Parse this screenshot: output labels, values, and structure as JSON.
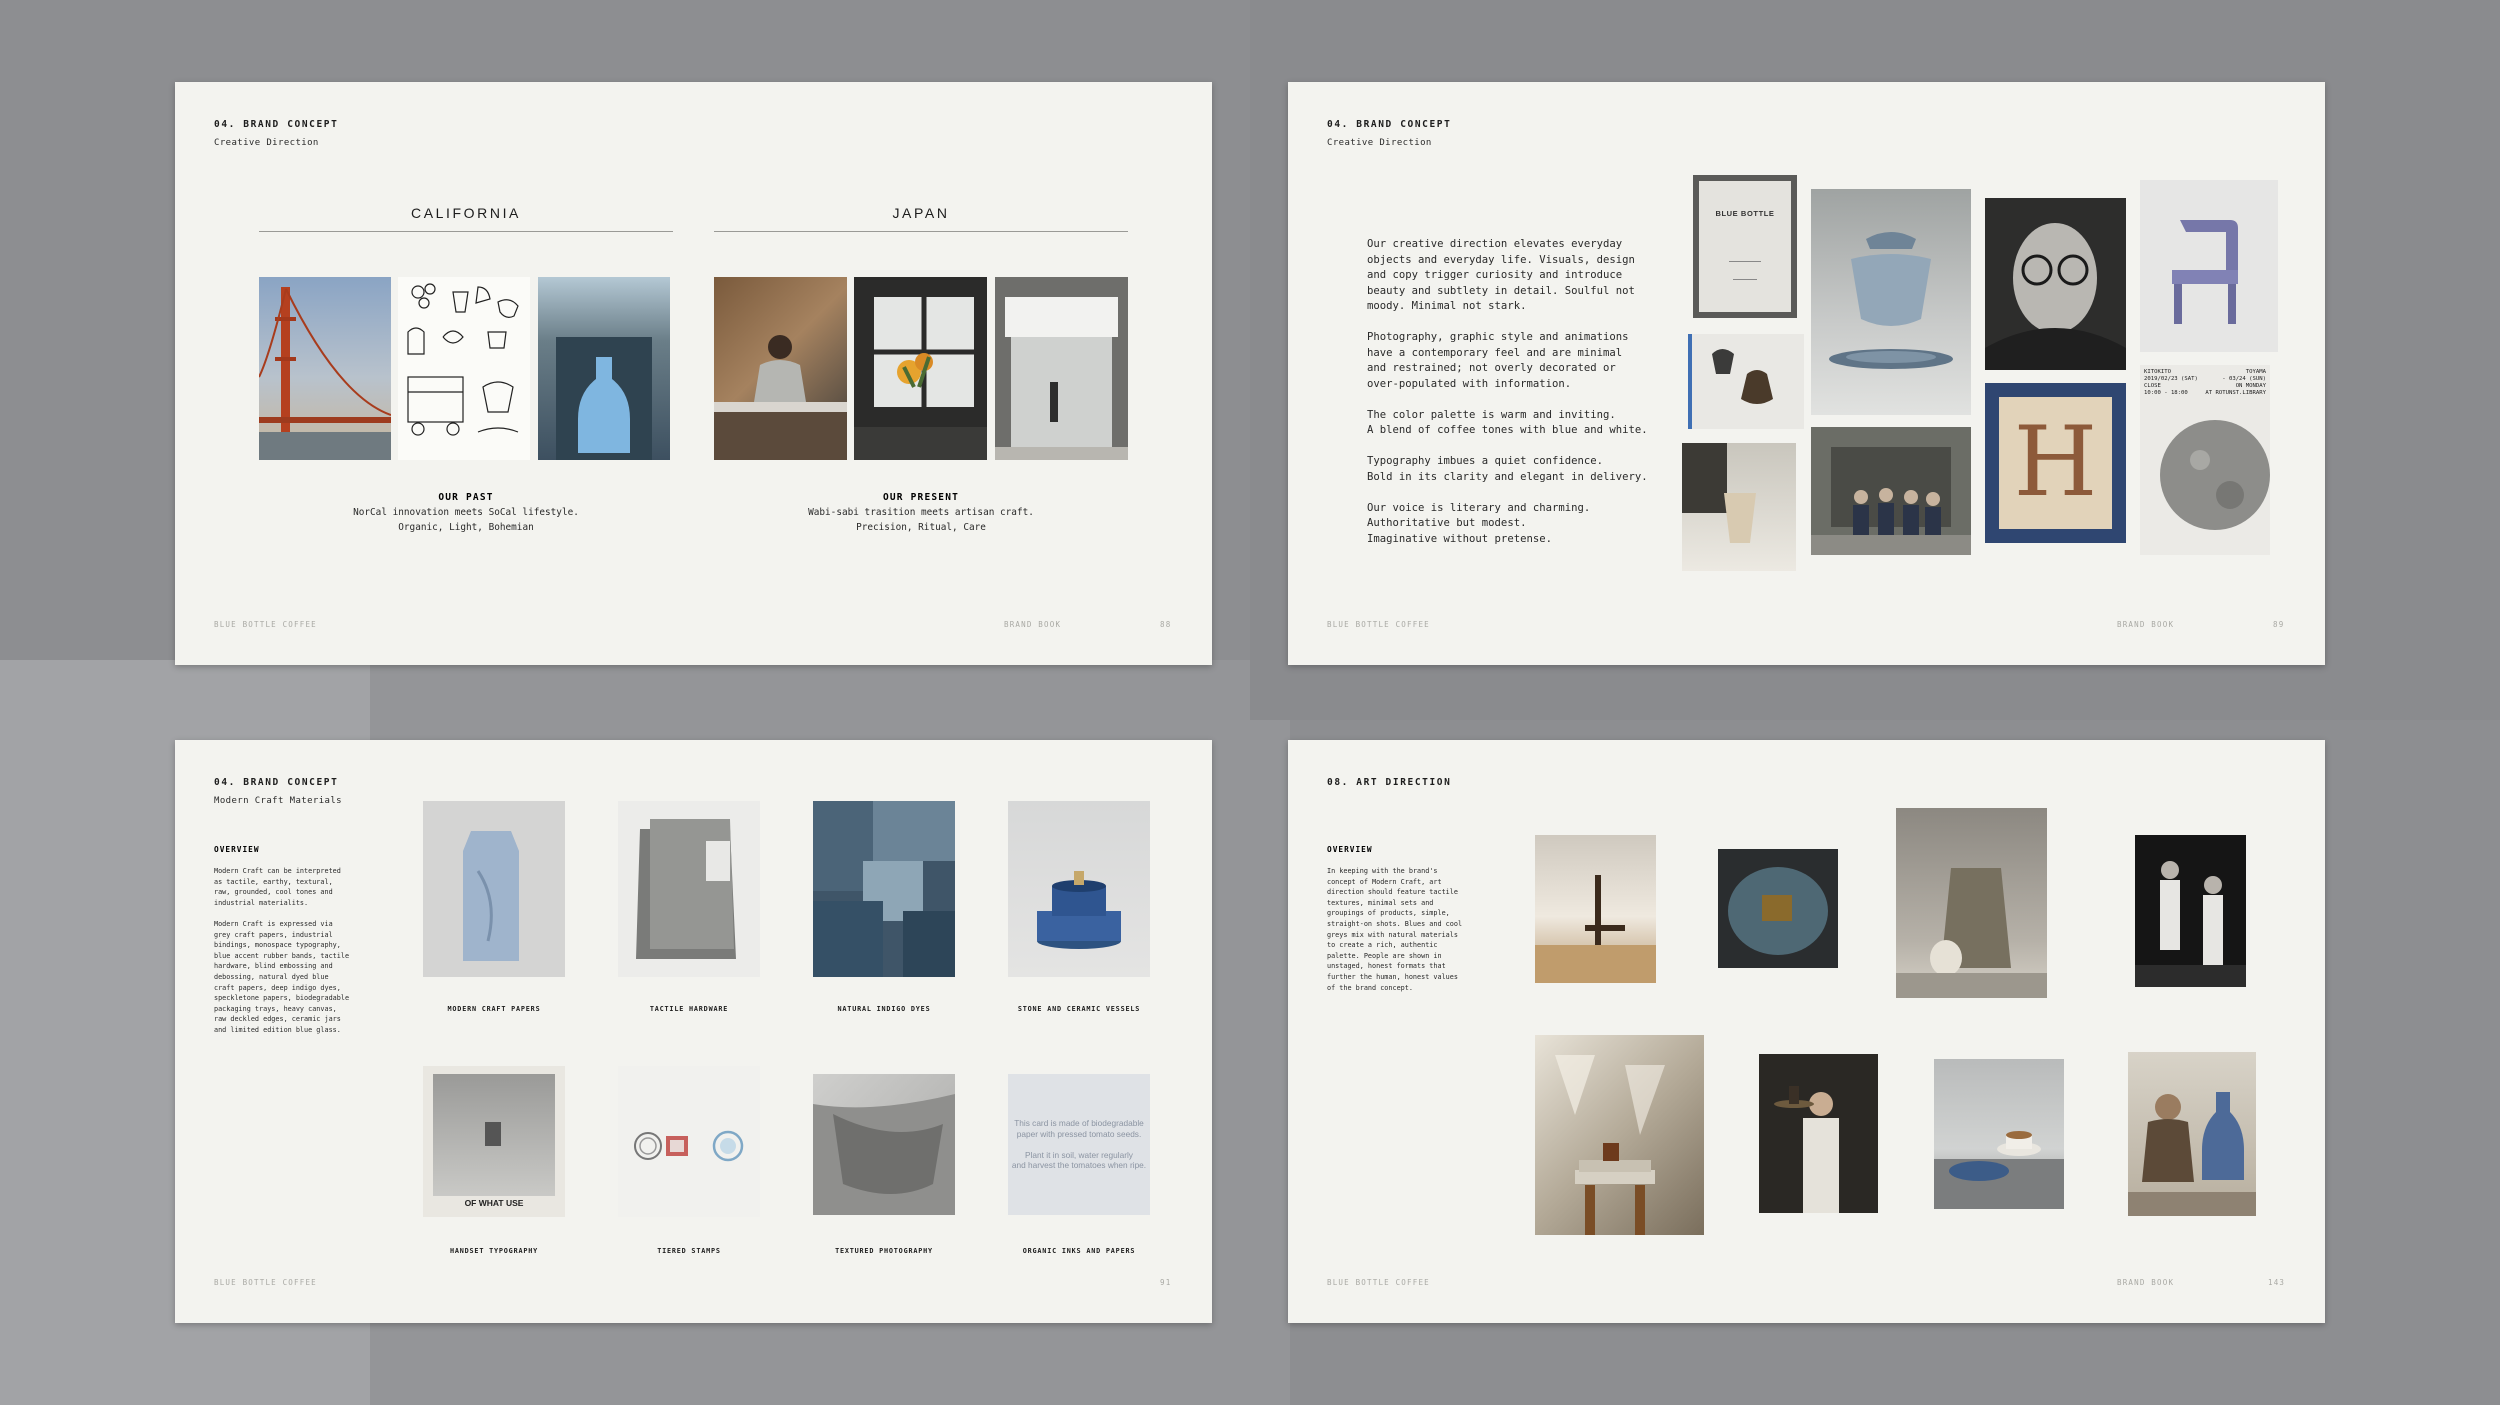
{
  "pages": {
    "p1": {
      "section": "04. BRAND CONCEPT",
      "subtitle": "Creative Direction",
      "california": "CALIFORNIA",
      "japan": "JAPAN",
      "past_title": "OUR PAST",
      "past_line1": "NorCal innovation meets SoCal lifestyle.",
      "past_line2": "Organic, Light, Bohemian",
      "present_title": "OUR PRESENT",
      "present_line1": "Wabi-sabi trasition meets artisan craft.",
      "present_line2": "Precision, Ritual, Care",
      "footer_brand": "BLUE BOTTLE COFFEE",
      "footer_book": "BRAND BOOK",
      "page_num": "88"
    },
    "p2": {
      "section": "04. BRAND CONCEPT",
      "subtitle": "Creative Direction",
      "body": "Our creative direction elevates everyday\nobjects and everyday life. Visuals, design\nand copy trigger curiosity and introduce\nbeauty and subtlety in detail. Soulful not\nmoody. Minimal not stark.\n\nPhotography, graphic style and animations\nhave a contemporary feel and are minimal\nand restrained; not overly decorated or\nover-populated with information.\n\nThe color palette is warm and inviting.\nA blend of coffee tones with blue and white.\n\nTypography imbues a quiet confidence.\nBold in its clarity and elegant in delivery.\n\nOur voice is literary and charming.\nAuthoritative but modest.\nImaginative without pretense.",
      "book_cover_title": "BLUE BOTTLE",
      "poster_left": "KITOKITO\n2019/02/23 (SAT)\nCLOSE\n10:00 - 18:00",
      "poster_right": "TOYAMA\n- 03/24 (SUN)\nON MONDAY\nAT ROTUNST.LIBRARY",
      "footer_brand": "BLUE BOTTLE COFFEE",
      "footer_book": "BRAND BOOK",
      "page_num": "89"
    },
    "p3": {
      "section": "04. BRAND CONCEPT",
      "subtitle": "Modern Craft Materials",
      "overview": "OVERVIEW",
      "body": "Modern Craft can be interpreted\nas tactile, earthy, textural,\nraw, grounded, cool tones and\nindustrial materialits.\n\nModern Craft is expressed via\ngrey craft papers, industrial\nbindings, monospace typography,\nblue accent rubber bands, tactile\nhardware, blind embossing and\ndebossing, natural dyed blue\ncraft papers, deep indigo dyes,\nspeckletone papers, biodegradable\npackaging trays, heavy canvas,\nraw deckled edges, ceramic jars\nand limited edition blue glass.",
      "captions": [
        "MODERN CRAFT PAPERS",
        "TACTILE HARDWARE",
        "NATURAL INDIGO DYES",
        "STONE AND CERAMIC VESSELS",
        "HANDSET TYPOGRAPHY",
        "TIERED STAMPS",
        "TEXTURED PHOTOGRAPHY",
        "ORGANIC INKS AND PAPERS"
      ],
      "print_text": "OF WHAT USE",
      "card_text": "This card is made of biodegradable\npaper with pressed tomato seeds.\n\nPlant it in soil, water regularly\nand harvest the tomatoes when ripe.",
      "footer_brand": "BLUE BOTTLE COFFEE",
      "page_num": "91"
    },
    "p4": {
      "section": "08. ART DIRECTION",
      "overview": "OVERVIEW",
      "body": "In keeping with the brand's\nconcept of Modern Craft, art\ndirection should feature tactile\ntextures, minimal sets and\ngroupings of products, simple,\nstraight-on shots. Blues and cool\ngreys mix with natural materials\nto create a rich, authentic\npalette. People are shown in\nunstaged, honest formats that\nfurther the human, honest values\nof the brand concept.",
      "footer_brand": "BLUE BOTTLE COFFEE",
      "footer_book": "BRAND BOOK",
      "page_num": "143"
    }
  },
  "colors": {
    "background": "#8d8e91",
    "page": "#f3f3ef",
    "accent_blue": "#3f6fb4"
  }
}
